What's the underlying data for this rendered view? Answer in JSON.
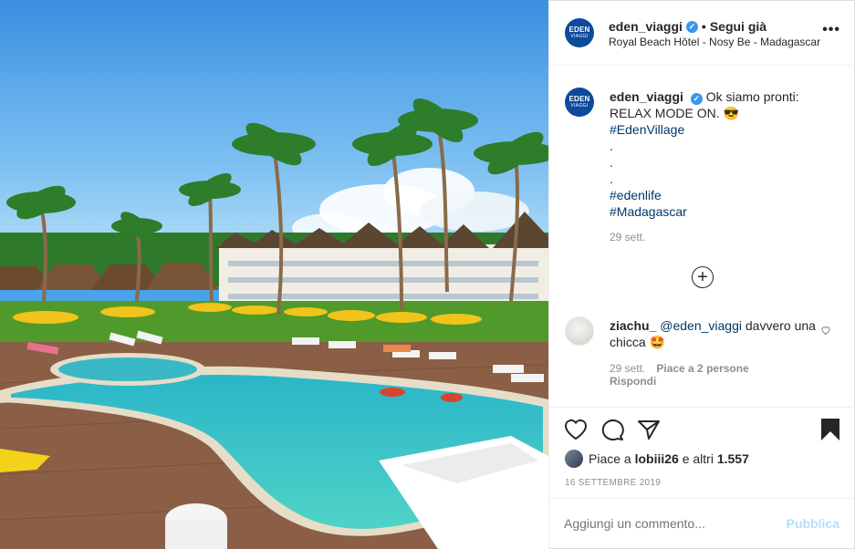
{
  "post": {
    "username": "eden_viaggi",
    "verified_mark": "✓",
    "separator": "•",
    "follow_status": "Segui già",
    "location": "Royal Beach Hôtel - Nosy Be - Madagascar",
    "more_icon": "•••",
    "avatar_text_top": "EDEN",
    "avatar_text_bottom": "VIAGGI"
  },
  "caption": {
    "username": "eden_viaggi",
    "text_line1": "Ok siamo pronti:",
    "text_line2": "RELAX MODE ON. 😎",
    "hashtag1": "#EdenVillage",
    "dots": [
      ".",
      ".",
      "."
    ],
    "hashtag2": "#edenlife",
    "hashtag3": "#Madagascar",
    "time": "29 sett."
  },
  "load_more_icon": "+",
  "comment": {
    "username": "ziachu_",
    "mention": "@eden_viaggi",
    "text": "davvero una chicca 🤩",
    "time": "29 sett.",
    "likes": "Piace a 2 persone",
    "reply": "Rispondi"
  },
  "likes": {
    "prefix": "Piace a",
    "user": "lobiii26",
    "middle": "e altri",
    "count": "1.557"
  },
  "date": "16 SETTEMBRE 2019",
  "add_comment": {
    "placeholder": "Aggiungi un commento...",
    "publish": "Pubblica"
  },
  "icons": {
    "like": "heart-icon",
    "comment": "comment-bubble-icon",
    "share": "paper-plane-icon",
    "save": "bookmark-icon"
  },
  "colors": {
    "link": "#00376b",
    "verified": "#3897f0",
    "publish_disabled": "#b2dffc",
    "brand_avatar": "#0d4a9b"
  }
}
